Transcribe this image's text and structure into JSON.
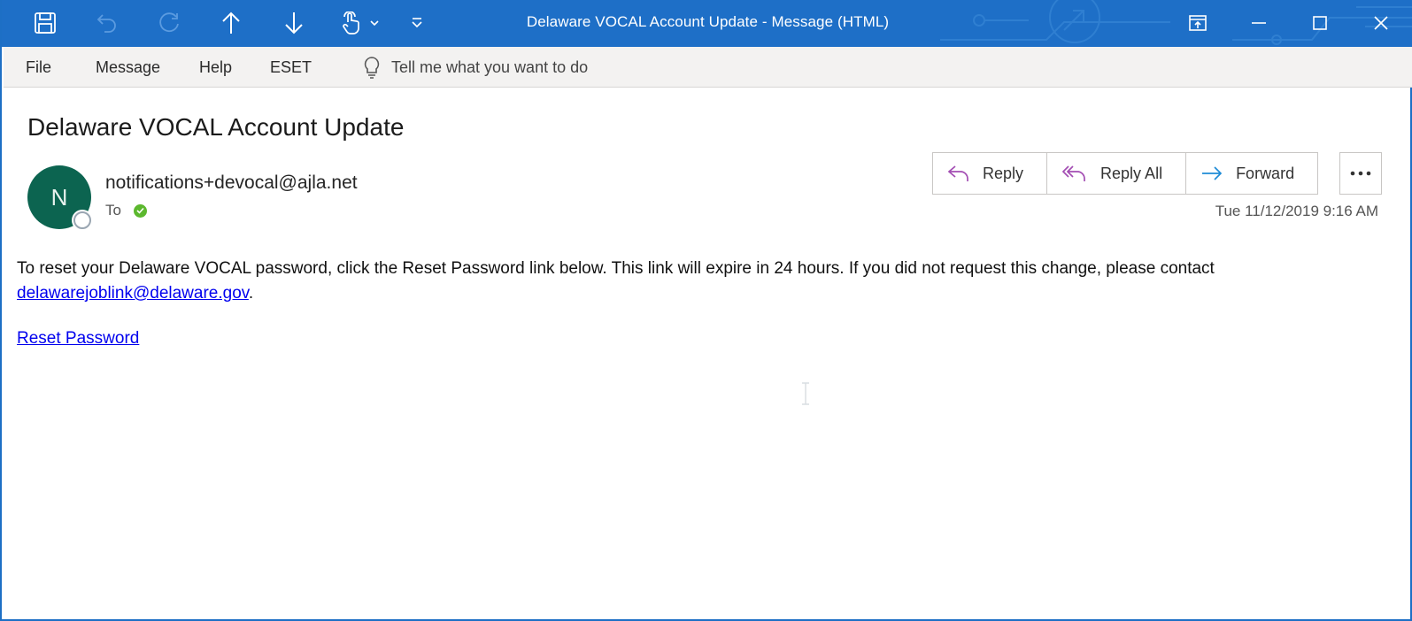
{
  "window": {
    "title": "Delaware VOCAL Account Update  -  Message (HTML)"
  },
  "quick_access": [
    {
      "name": "save-icon"
    },
    {
      "name": "undo-icon"
    },
    {
      "name": "redo-icon"
    },
    {
      "name": "previous-item-icon"
    },
    {
      "name": "next-item-icon"
    },
    {
      "name": "touch-mode-icon"
    },
    {
      "name": "customize-toolbar-icon"
    }
  ],
  "menu": {
    "file": "File",
    "message": "Message",
    "help": "Help",
    "eset": "ESET",
    "tell_me": "Tell me what you want to do"
  },
  "message": {
    "subject": "Delaware VOCAL Account Update",
    "avatar_initial": "N",
    "sender": "notifications+devocal@ajla.net",
    "to_label": "To",
    "date": "Tue 11/12/2019 9:16 AM",
    "body_text": "To reset your Delaware VOCAL password, click the Reset Password link below. This link will expire in 24 hours. If you did not request this change, please contact ",
    "contact_email": "delawarejoblink@delaware.gov",
    "body_period": ".",
    "reset_link": "Reset Password"
  },
  "actions": {
    "reply": "Reply",
    "reply_all": "Reply All",
    "forward": "Forward"
  },
  "colors": {
    "titlebar": "#1e6fc7",
    "avatar": "#0c6450",
    "reply_icon": "#a34db3",
    "forward_icon": "#1e8bd6"
  }
}
